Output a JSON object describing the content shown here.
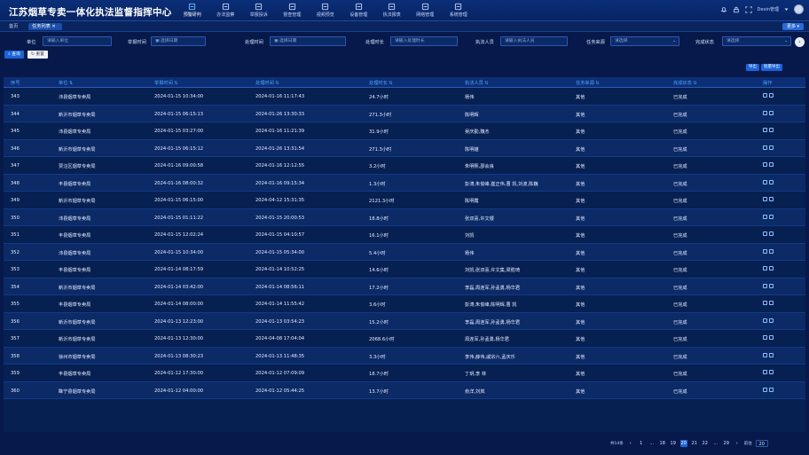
{
  "app_title": "江苏烟草专卖一体化执法监督指挥中心",
  "nav": [
    "预警研判",
    "办法监察",
    "举报投诉",
    "督查管理",
    "视频预览",
    "设备管理",
    "执法报表",
    "网络管理",
    "系统管理"
  ],
  "user": "Devin管理",
  "tabs": [
    "首页",
    "任务列表"
  ],
  "tab_menu": "更多",
  "filters": [
    {
      "label": "单位",
      "placeholder": "请输入单位"
    },
    {
      "label": "举报时间",
      "placeholder": "选择日期"
    },
    {
      "label": "处理时间",
      "placeholder": "选择日期"
    },
    {
      "label": "处理时长",
      "placeholder": "请输入处理时长"
    },
    {
      "label": "执法人员",
      "placeholder": "请输入执法人员"
    },
    {
      "label": "任务来源",
      "placeholder": "请选择"
    },
    {
      "label": "完成状态",
      "placeholder": "请选择"
    }
  ],
  "buttons": {
    "query": "查询",
    "reset": "重置",
    "export": "导出",
    "more": "批量导出"
  },
  "columns": [
    "序号",
    "单位",
    "举报时间",
    "处理时间",
    "处理时长",
    "执法人员",
    "任务来源",
    "完成状态",
    "操作"
  ],
  "rows": [
    [
      "343",
      "沛县烟草专卖局",
      "2024-01-15 10:34:00",
      "2024-01-16 11:17:43",
      "24.7小时",
      "杨伟",
      "其他",
      "已完成"
    ],
    [
      "344",
      "新沂市烟草专卖局",
      "2024-01-15 06:15:13",
      "2024-01-26 13:30:33",
      "271.3小时",
      "陈明辉",
      "其他",
      "已完成"
    ],
    [
      "345",
      "沛县烟草专卖局",
      "2024-01-15 03:27:00",
      "2024-01-16 11:21:39",
      "31.9小时",
      "吴庆勤,魏杰",
      "其他",
      "已完成"
    ],
    [
      "346",
      "新沂市烟草专卖局",
      "2024-01-15 06:15:12",
      "2024-01-26 13:31:54",
      "271.3小时",
      "陈明雄",
      "其他",
      "已完成"
    ],
    [
      "347",
      "贾汪区烟草专卖局",
      "2024-01-16 09:00:58",
      "2024-01-16 12:12:55",
      "3.2小时",
      "朱明熙,邵会良",
      "其他",
      "已完成"
    ],
    [
      "348",
      "丰县烟草专卖局",
      "2024-01-16 08:00:32",
      "2024-01-16 09:15:34",
      "1.3小时",
      "彭涛,朱俊峰,崔正伟,曹 凯,刘波,陈巍",
      "其他",
      "已完成"
    ],
    [
      "349",
      "新沂市烟草专卖局",
      "2024-01-15 06:15:00",
      "2024-04-12 15:31:35",
      "2121.3小时",
      "陈明霞",
      "其他",
      "已完成"
    ],
    [
      "350",
      "沛县烟草专卖局",
      "2024-01-15 01:11:22",
      "2024-01-15 20:00:53",
      "18.8小时",
      "张双喜,许文银",
      "其他",
      "已完成"
    ],
    [
      "351",
      "丰县烟草专卖局",
      "2024-01-15 12:02:24",
      "2024-01-15 04:10:57",
      "16.1小时",
      "刘凯",
      "其他",
      "已完成"
    ],
    [
      "352",
      "沛县烟草专卖局",
      "2024-01-15 10:34:00",
      "2024-01-15 05:34:00",
      "5.4小时",
      "杨伟",
      "其他",
      "已完成"
    ],
    [
      "353",
      "丰县烟草专卖局",
      "2024-01-14 08:17:59",
      "2024-01-14 10:52:25",
      "14.6小时",
      "刘凯,张双喜,许文集,梁胜琦",
      "其他",
      "已完成"
    ],
    [
      "354",
      "新沂市烟草专卖局",
      "2024-01-14 03:42:00",
      "2024-01-14 08:56:11",
      "17.2小时",
      "李磊,周连军,孙孟勇,杨华君",
      "其他",
      "已完成"
    ],
    [
      "355",
      "丰县烟草专卖局",
      "2024-01-14 08:00:00",
      "2024-01-14 11:55:42",
      "3.6小时",
      "彭涛,朱俊峰,陈明辉,曹 凯",
      "其他",
      "已完成"
    ],
    [
      "356",
      "新沂市烟草专卖局",
      "2024-01-13 12:23:00",
      "2024-01-13 03:54:23",
      "15.2小时",
      "李磊,周连军,孙孟勇,杨华君",
      "其他",
      "已完成"
    ],
    [
      "357",
      "新沂市烟草专卖局",
      "2024-01-13 12:30:00",
      "2024-04-08 17:04:04",
      "2068.6小时",
      "周连军,孙孟勇,杨华君",
      "其他",
      "已完成"
    ],
    [
      "358",
      "徐州市烟草专卖局",
      "2024-01-13 08:30:23",
      "2024-01-13 11:48:35",
      "3.3小时",
      "李伟,薛伟,戚宗六,孟庆乐",
      "其他",
      "已完成"
    ],
    [
      "359",
      "丰县烟草专卖局",
      "2024-01-12 17:30:00",
      "2024-01-12 07:09:09",
      "18.7小时",
      "丁玥,李 林",
      "其他",
      "已完成"
    ],
    [
      "360",
      "睢宁县烟草专卖局",
      "2024-01-12 04:00:00",
      "2024-01-12 05:44:25",
      "13.7小时",
      "俞洋,刘岚",
      "其他",
      "已完成"
    ]
  ],
  "pagination": {
    "total": "共14条",
    "pages": [
      "1",
      "...",
      "18",
      "19",
      "20",
      "21",
      "22",
      "...",
      "29"
    ],
    "current": "20",
    "goto_label": "前往",
    "goto_value": "20"
  }
}
